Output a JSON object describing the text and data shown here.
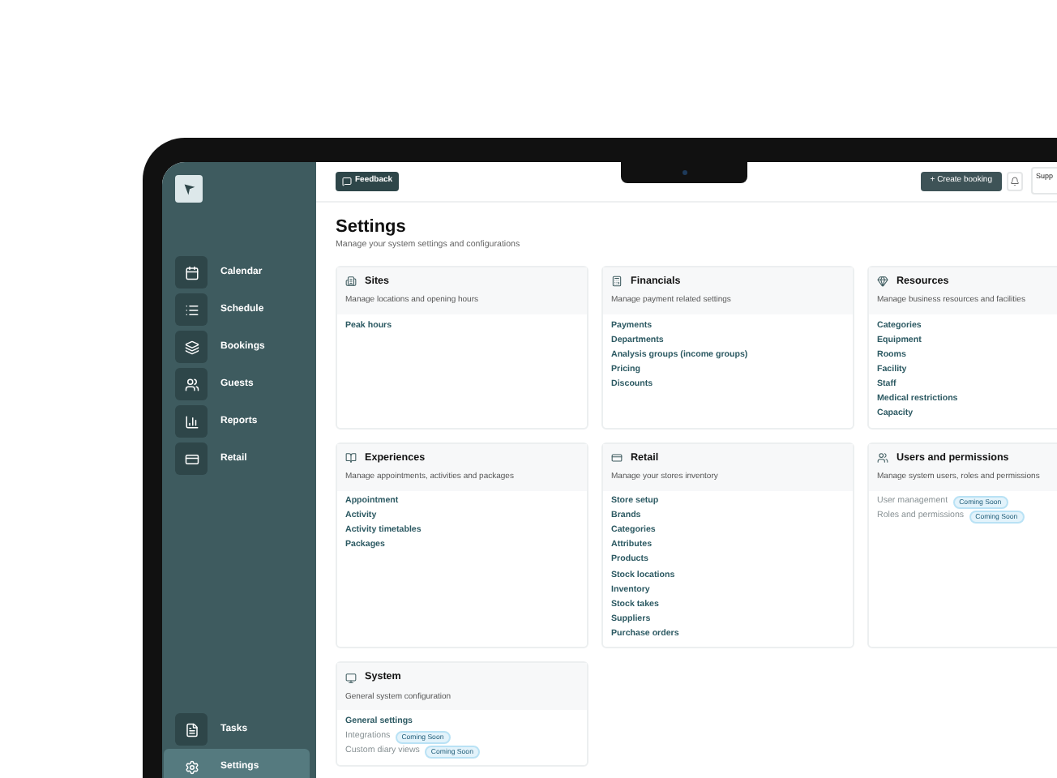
{
  "topbar": {
    "feedback_button": "Feedback",
    "create_button": "+ Create booking",
    "account_button": "Supp"
  },
  "sidebar": {
    "items": [
      {
        "label": "Calendar",
        "selected": false
      },
      {
        "label": "Schedule",
        "selected": false
      },
      {
        "label": "Bookings",
        "selected": false
      },
      {
        "label": "Guests",
        "selected": false
      },
      {
        "label": "Reports",
        "selected": false
      },
      {
        "label": "Retail",
        "selected": false
      }
    ],
    "bottom_items": [
      {
        "label": "Tasks",
        "selected": false
      },
      {
        "label": "Settings",
        "selected": true
      }
    ]
  },
  "page": {
    "title": "Settings",
    "subtitle": "Manage your system settings and configurations"
  },
  "cards": [
    {
      "title": "Sites",
      "description": "Manage locations and opening hours",
      "items": [
        {
          "label": "Peak hours",
          "kind": "link"
        }
      ]
    },
    {
      "title": "Financials",
      "description": "Manage payment related settings",
      "items": [
        {
          "label": "Payments",
          "kind": "link"
        },
        {
          "label": "Departments",
          "kind": "link"
        },
        {
          "label": "Analysis groups (income groups)",
          "kind": "link"
        },
        {
          "label": "Pricing",
          "kind": "link"
        },
        {
          "label": "Discounts",
          "kind": "link"
        }
      ]
    },
    {
      "title": "Resources",
      "description": "Manage business resources and facilities",
      "items": [
        {
          "label": "Categories",
          "kind": "link"
        },
        {
          "label": "Equipment",
          "kind": "link"
        },
        {
          "label": "Rooms",
          "kind": "link"
        },
        {
          "label": "Facility",
          "kind": "link"
        },
        {
          "label": "Staff",
          "kind": "link"
        },
        {
          "label": "Medical restrictions",
          "kind": "link"
        },
        {
          "label": "Capacity",
          "kind": "link"
        }
      ]
    },
    {
      "title": "Experiences",
      "description": "Manage appointments, activities and packages",
      "items": [
        {
          "label": "Appointment",
          "kind": "link"
        },
        {
          "label": "Activity",
          "kind": "link"
        },
        {
          "label": "Activity timetables",
          "kind": "link"
        },
        {
          "label": "Packages",
          "kind": "link"
        }
      ]
    },
    {
      "title": "Retail",
      "description": "Manage your stores inventory",
      "items": [
        {
          "label": "Store setup",
          "kind": "link"
        },
        {
          "label": "Brands",
          "kind": "link"
        },
        {
          "label": "Categories",
          "kind": "link"
        },
        {
          "label": "Attributes",
          "kind": "link"
        },
        {
          "label": "Products",
          "kind": "link"
        },
        {
          "label": "Stock locations",
          "kind": "link"
        },
        {
          "label": "Inventory",
          "kind": "link"
        },
        {
          "label": "Stock takes",
          "kind": "link"
        },
        {
          "label": "Suppliers",
          "kind": "link"
        },
        {
          "label": "Purchase orders",
          "kind": "link"
        }
      ]
    },
    {
      "title": "Users and permissions",
      "description": "Manage system users, roles and permissions",
      "items": [
        {
          "label": "User management",
          "kind": "coming_soon",
          "badge": "Coming Soon"
        },
        {
          "label": "Roles and permissions",
          "kind": "coming_soon",
          "badge": "Coming Soon"
        }
      ]
    },
    {
      "title": "System",
      "description": "General system configuration",
      "items": [
        {
          "label": "General settings",
          "kind": "link"
        },
        {
          "label": "Integrations",
          "kind": "coming_soon",
          "badge": "Coming Soon"
        },
        {
          "label": "Custom diary views",
          "kind": "coming_soon",
          "badge": "Coming Soon"
        }
      ]
    }
  ]
}
